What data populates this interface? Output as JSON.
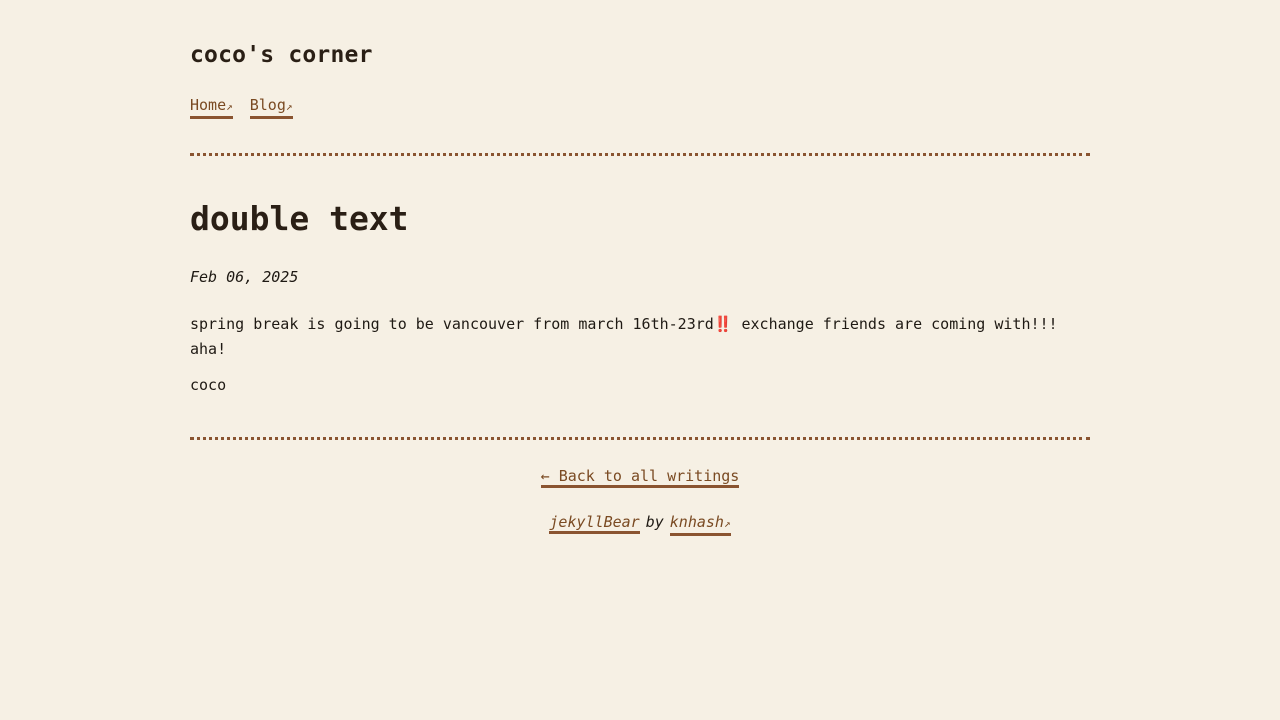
{
  "site": {
    "title": "coco's corner"
  },
  "nav": {
    "items": [
      {
        "label": "Home",
        "arrow": "↗"
      },
      {
        "label": "Blog",
        "arrow": "↗"
      }
    ]
  },
  "post": {
    "title": "double text",
    "date": "Feb 06, 2025",
    "body": "spring break is going to be vancouver from march 16th-23rd‼️ exchange friends are coming with!!! aha!",
    "signoff": "coco"
  },
  "footer": {
    "back_label": "← Back to all writings",
    "theme_name": "jekyllBear",
    "by_text": "by",
    "author": "knhash",
    "author_arrow": "↗"
  },
  "colors": {
    "background": "#f6f0e4",
    "link": "#7a4a22",
    "accent": "#8a5430",
    "text": "#1f1a14"
  }
}
